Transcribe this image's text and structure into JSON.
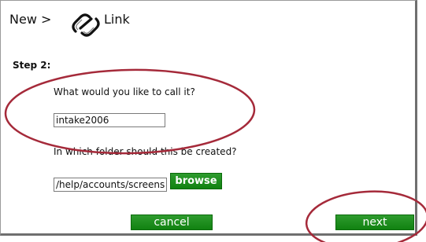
{
  "header": {
    "breadcrumb": "New >",
    "title": "Link",
    "icon": "chain-link-icon"
  },
  "step": {
    "label": "Step 2:"
  },
  "name_prompt": "What would you like to call it?",
  "name_input": {
    "value": "intake2006"
  },
  "folder_prompt": "In which folder should this be created?",
  "folder_input": {
    "value": "/help/accounts/screens"
  },
  "buttons": {
    "browse": "browse",
    "cancel": "cancel",
    "next": "next"
  },
  "colors": {
    "button_green": "#1a8f1a",
    "annotation_red": "#a52a3a"
  }
}
